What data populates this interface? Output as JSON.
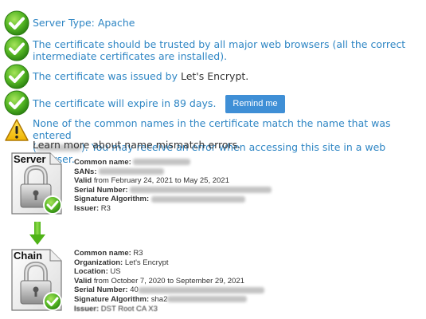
{
  "checks": [
    {
      "text": "Server Type: Apache"
    },
    {
      "text": "The certificate should be trusted by all major web browsers (all the correct intermediate certificates are installed)."
    },
    {
      "prefix": "The certificate was issued by ",
      "issuer": "Let's Encrypt",
      "suffix": "."
    },
    {
      "text": "The certificate will expire in 89 days.",
      "button": "Remind me"
    }
  ],
  "warning": {
    "line1": "None of the common names in the certificate match the name that was entered",
    "line2": "). You may receive an error when accessing this site in a web browser.",
    "learn": "Learn more about name mismatch errors."
  },
  "server_cert": {
    "label": "Server",
    "fields": {
      "common_name": "Common name:",
      "sans": "SANs:",
      "valid_k": "Valid",
      "valid_v": " from February 24, 2021 to May 25, 2021",
      "serial": "Serial Number:",
      "sigalg": "Signature Algorithm:",
      "issuer_k": "Issuer:",
      "issuer_v": " R3"
    }
  },
  "chain_cert": {
    "label": "Chain",
    "fields": {
      "common_name_k": "Common name:",
      "common_name_v": " R3",
      "org_k": "Organization:",
      "org_v": " Let's Encrypt",
      "loc_k": "Location:",
      "loc_v": " US",
      "valid_k": "Valid",
      "valid_v": " from October 7, 2020 to September 29, 2021",
      "serial_k": "Serial Number:",
      "serial_v": " 40",
      "sigalg_k": "Signature Algorithm:",
      "sigalg_v": " sha2",
      "issuer_k": "Issuer:",
      "issuer_v": " DST Root CA X3"
    }
  },
  "colors": {
    "accent": "#2f86c4",
    "button": "#3f8fd6",
    "check": "#5cb82b",
    "warning": "#f2c200"
  }
}
